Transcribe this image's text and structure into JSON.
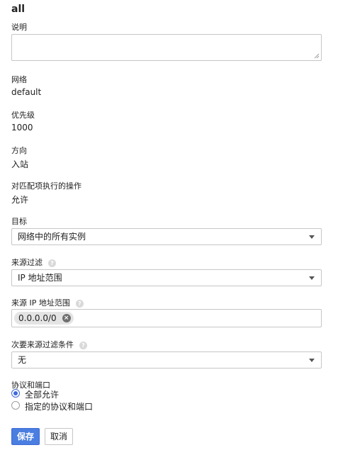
{
  "rule": {
    "name": "all"
  },
  "description": {
    "label": "说明",
    "value": ""
  },
  "network": {
    "label": "网络",
    "value": "default"
  },
  "priority": {
    "label": "优先级",
    "value": "1000"
  },
  "direction": {
    "label": "方向",
    "value": "入站"
  },
  "action": {
    "label": "对匹配项执行的操作",
    "value": "允许"
  },
  "target": {
    "label": "目标",
    "selected": "网络中的所有实例"
  },
  "source_filter": {
    "label": "来源过滤",
    "help_icon": "question-icon",
    "selected": "IP 地址范围"
  },
  "source_ip_ranges": {
    "label": "来源 IP 地址范围",
    "help_icon": "question-icon",
    "chips": [
      "0.0.0.0/0"
    ]
  },
  "secondary_source_filter": {
    "label": "次要来源过滤条件",
    "help_icon": "question-icon",
    "selected": "无"
  },
  "protocols_ports": {
    "label": "协议和端口",
    "options": [
      {
        "label": "全部允许",
        "checked": true
      },
      {
        "label": "指定的协议和端口",
        "checked": false
      }
    ]
  },
  "buttons": {
    "save": "保存",
    "cancel": "取消"
  },
  "colors": {
    "primary": "#4a7ee0",
    "border": "#c6c6c6",
    "radio_accent": "#3f6ad8"
  }
}
